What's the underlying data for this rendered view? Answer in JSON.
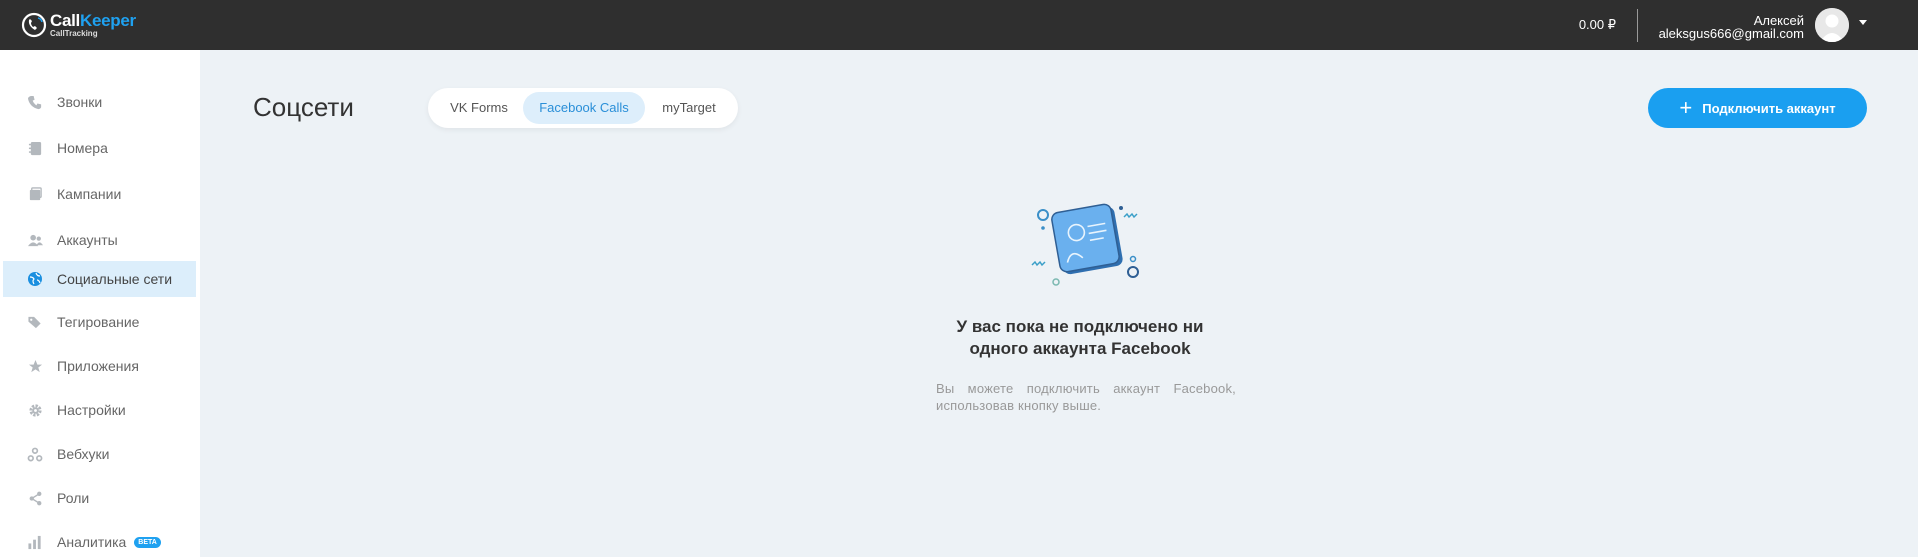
{
  "header": {
    "logo_main": "Call",
    "logo_accent": "Keeper",
    "logo_sub": "CallTracking",
    "balance": "0.00 ₽",
    "user_name": "Алексей",
    "user_email": "aleksgus666@gmail.com"
  },
  "sidebar": {
    "items": [
      {
        "label": "Звонки",
        "icon": "phone-icon"
      },
      {
        "label": "Номера",
        "icon": "numbers-icon"
      },
      {
        "label": "Кампании",
        "icon": "campaigns-icon"
      },
      {
        "label": "Аккаунты",
        "icon": "accounts-icon"
      },
      {
        "label": "Социальные сети",
        "icon": "globe-icon",
        "active": true
      },
      {
        "label": "Тегирование",
        "icon": "tags-icon"
      },
      {
        "label": "Приложения",
        "icon": "star-icon"
      },
      {
        "label": "Настройки",
        "icon": "gear-icon"
      },
      {
        "label": "Вебхуки",
        "icon": "webhooks-icon"
      },
      {
        "label": "Роли",
        "icon": "share-icon"
      },
      {
        "label": "Аналитика",
        "icon": "bar-chart-icon",
        "badge": "BETA"
      }
    ]
  },
  "main": {
    "title": "Соцсети",
    "tabs": [
      {
        "label": "VK Forms"
      },
      {
        "label": "Facebook Calls",
        "active": true
      },
      {
        "label": "myTarget"
      }
    ],
    "connect_button": "Подключить аккаунт",
    "empty_title_1": "У вас пока не подключено ни",
    "empty_title_2": "одного аккаунта Facebook",
    "empty_desc": "Вы можете подключить аккаунт Facebook, использовав кнопку выше."
  },
  "colors": {
    "topbar": "#2f2f2f",
    "accent": "#1a9ff0",
    "background": "#edf2f6",
    "active_nav": "#dceefb"
  }
}
